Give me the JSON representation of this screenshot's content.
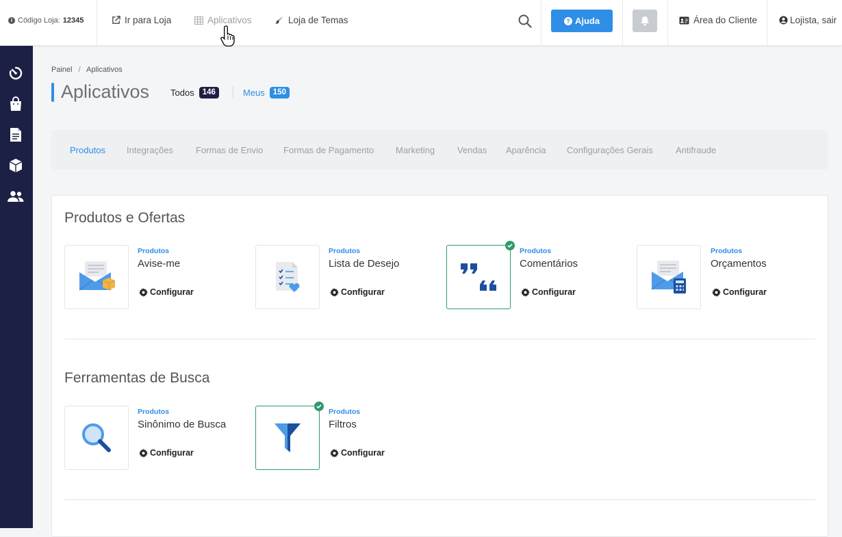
{
  "topbar": {
    "store_code_label": "Código Loja:",
    "store_code_value": "12345",
    "go_to_store": "Ir para Loja",
    "apps": "Aplicativos",
    "theme_store": "Loja de Temas",
    "help": "Ajuda",
    "client_area": "Área do Cliente",
    "logout": "Lojista, sair"
  },
  "sidebar": {
    "icons": [
      "dashboard-icon",
      "shopping-bag-icon",
      "document-icon",
      "box-icon",
      "users-icon"
    ]
  },
  "breadcrumb": {
    "root": "Painel",
    "sep": "/",
    "current": "Aplicativos"
  },
  "page": {
    "title": "Aplicativos",
    "filter_all": "Todos",
    "filter_all_count": "146",
    "filter_mine": "Meus",
    "filter_mine_count": "150"
  },
  "categories": [
    "Produtos",
    "Integrações",
    "Formas de Envio",
    "Formas de Pagamento",
    "Marketing",
    "Vendas",
    "Aparência",
    "Configurações Gerais",
    "Antifraude"
  ],
  "sections": [
    {
      "title": "Produtos e Ofertas",
      "apps": [
        {
          "category": "Produtos",
          "name": "Avise-me",
          "action": "Configurar",
          "installed": false,
          "icon": "mail-box-icon"
        },
        {
          "category": "Produtos",
          "name": "Lista de Desejo",
          "action": "Configurar",
          "installed": false,
          "icon": "wishlist-icon"
        },
        {
          "category": "Produtos",
          "name": "Comentários",
          "action": "Configurar",
          "installed": true,
          "icon": "quotes-icon"
        },
        {
          "category": "Produtos",
          "name": "Orçamentos",
          "action": "Configurar",
          "installed": false,
          "icon": "mail-calculator-icon"
        }
      ]
    },
    {
      "title": "Ferramentas de Busca",
      "apps": [
        {
          "category": "Produtos",
          "name": "Sinônimo de Busca",
          "action": "Configurar",
          "installed": false,
          "icon": "magnifier-icon"
        },
        {
          "category": "Produtos",
          "name": "Filtros",
          "action": "Configurar",
          "installed": true,
          "icon": "funnel-icon"
        }
      ]
    }
  ],
  "colors": {
    "accent": "#2f8ee6",
    "sidebar": "#1d2045",
    "installed": "#2e9a6e",
    "badge_all": "#1d2045"
  }
}
